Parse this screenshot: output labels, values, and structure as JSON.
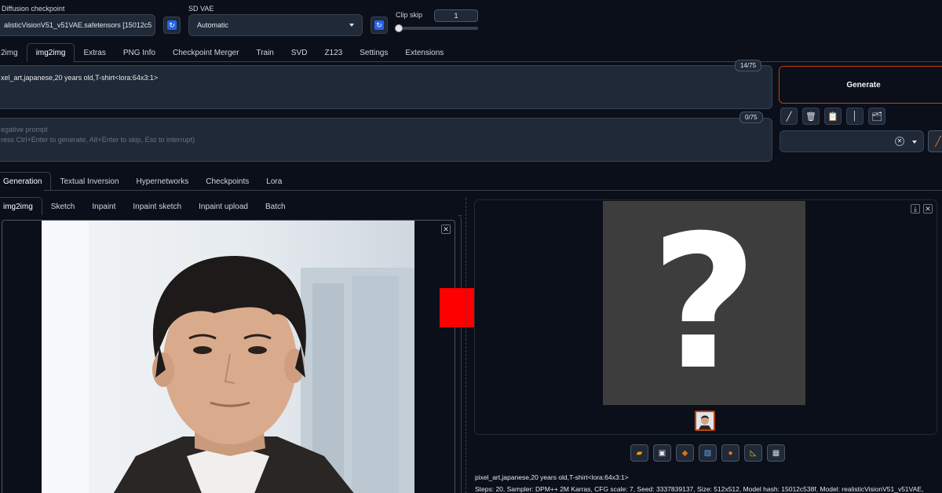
{
  "header": {
    "checkpoint_label": "Diffusion checkpoint",
    "checkpoint_value": "alisticVisionV51_v51VAE.safetensors [15012c5",
    "vae_label": "SD VAE",
    "vae_value": "Automatic",
    "clip_label": "Clip skip",
    "clip_value": "1"
  },
  "main_tabs": [
    "2img",
    "img2img",
    "Extras",
    "PNG Info",
    "Checkpoint Merger",
    "Train",
    "SVD",
    "Z123",
    "Settings",
    "Extensions"
  ],
  "prompt": {
    "text": "xel_art,japanese,20 years old,T-shirt<lora:64x3:1>",
    "counter": "14/75"
  },
  "negative": {
    "placeholder_line1": "egative prompt",
    "placeholder_line2": "ress Ctrl+Enter to generate, Alt+Enter to skip, Esc to interrupt)",
    "counter": "0/75"
  },
  "generate_label": "Generate",
  "extra_tabs": [
    "Generation",
    "Textual Inversion",
    "Hypernetworks",
    "Checkpoints",
    "Lora"
  ],
  "mode_tabs": [
    "img2img",
    "Sketch",
    "Inpaint",
    "Inpaint sketch",
    "Inpaint upload",
    "Batch"
  ],
  "output": {
    "question_mark": "?",
    "info_line1": "pixel_art,japanese,20 years old,T-shirt<lora:64x3:1>",
    "info_line2": "Steps: 20, Sampler: DPM++ 2M Karras, CFG scale: 7, Seed: 3337839137, Size: 512x512, Model hash: 15012c538f, Model: realisticVisionV51_v51VAE,"
  },
  "colors": {
    "background": "#0b0f19",
    "accent_orange": "#c2410c",
    "arrow_red": "#ff0000",
    "placeholder_gray": "#3d3d3d"
  },
  "icons": {
    "tool_buttons": [
      "pencil-icon",
      "trash-icon",
      "clipboard-icon",
      "pin-icon",
      "style-icon"
    ],
    "action_buttons": [
      "folder-icon",
      "save-icon",
      "zip-icon",
      "image-icon",
      "palette-icon",
      "ruler-icon",
      "grid-icon"
    ]
  }
}
